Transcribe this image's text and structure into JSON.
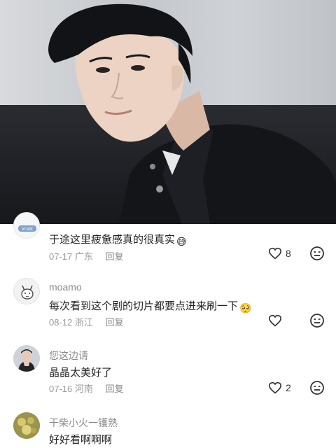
{
  "comments": [
    {
      "name": "",
      "text": "于途这里疲惫感真的很真实",
      "emoji": "😅",
      "date": "07-17",
      "location": "广东",
      "reply_label": "回复",
      "likes": "8",
      "avatar_icon": "vrabbit-logo-icon"
    },
    {
      "name": "moamo",
      "text": "每次看到这个剧的切片都要点进来刷一下",
      "emoji": "🥺",
      "date": "08-12",
      "location": "浙江",
      "reply_label": "回复",
      "likes": "",
      "avatar_icon": "cartoon-animal-avatar-icon"
    },
    {
      "name": "您这边请",
      "text": "晶晶太美好了",
      "emoji": "",
      "date": "07-16",
      "location": "河南",
      "reply_label": "回复",
      "likes": "2",
      "avatar_icon": "person-avatar-icon"
    },
    {
      "name": "干柴小火一镬熟",
      "text": "好好看啊啊啊",
      "emoji": "",
      "date": "",
      "location": "",
      "reply_label": "",
      "likes": "",
      "avatar_icon": "food-photo-avatar-icon"
    }
  ]
}
